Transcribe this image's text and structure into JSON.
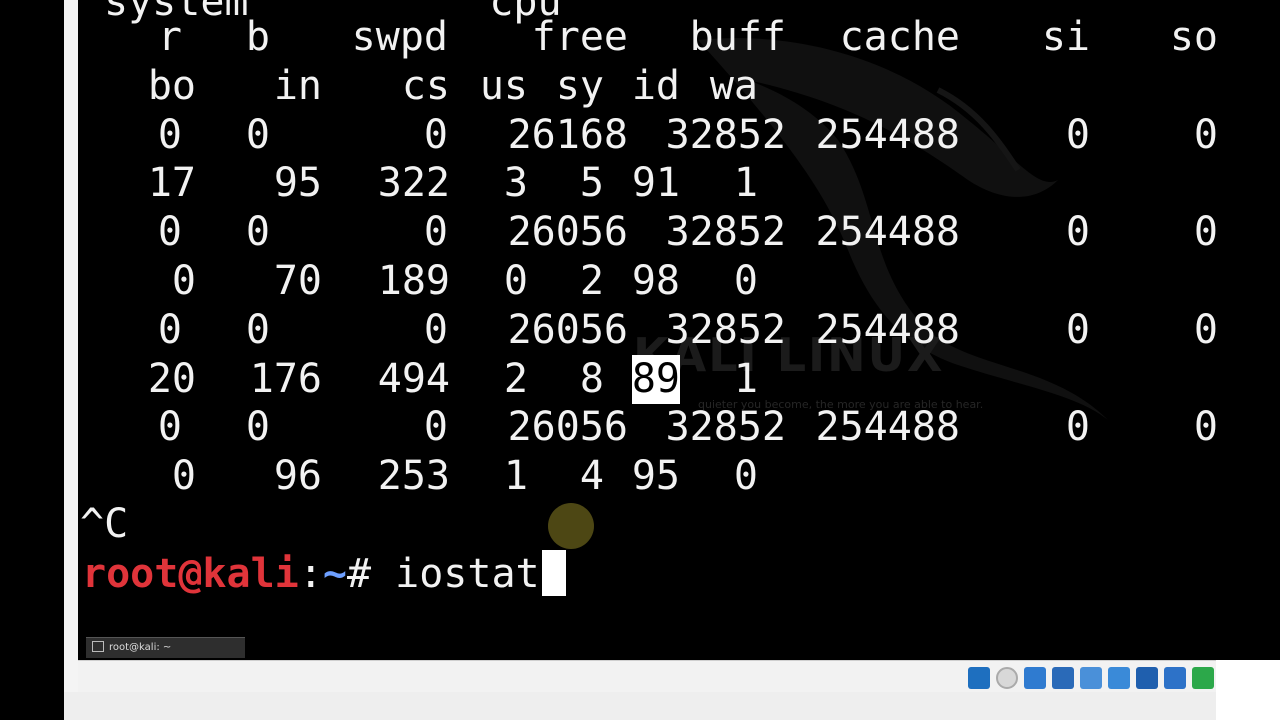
{
  "terminal": {
    "lines": [
      {
        "cells": [
          "r",
          "b",
          "swpd",
          "free",
          "buff",
          "cache",
          "si",
          "so"
        ]
      },
      {
        "cells": [
          "bo",
          "in",
          "cs",
          "us",
          "sy",
          "id",
          "wa"
        ]
      },
      {
        "cells": [
          "0",
          "0",
          "0",
          "26168",
          "32852",
          "254488",
          "0",
          "0"
        ]
      },
      {
        "cells": [
          "17",
          "95",
          "322",
          "3",
          "5",
          "91",
          "1"
        ]
      },
      {
        "cells": [
          "0",
          "0",
          "0",
          "26056",
          "32852",
          "254488",
          "0",
          "0"
        ]
      },
      {
        "cells": [
          "0",
          "70",
          "189",
          "0",
          "2",
          "98",
          "0"
        ]
      },
      {
        "cells": [
          "0",
          "0",
          "0",
          "26056",
          "32852",
          "254488",
          "0",
          "0"
        ]
      },
      {
        "cells": [
          "20",
          "176",
          "494",
          "2",
          "8",
          "89",
          "1"
        ]
      },
      {
        "cells": [
          "0",
          "0",
          "0",
          "26056",
          "32852",
          "254488",
          "0",
          "0"
        ]
      },
      {
        "cells": [
          "0",
          "96",
          "253",
          "1",
          "4",
          "95",
          "0"
        ]
      }
    ],
    "top_partial": "system          cpu",
    "interrupt": "^C",
    "prompt_user": "root@kali",
    "prompt_sep": ":",
    "prompt_path": "~",
    "prompt_symbol": "# ",
    "command": "iostat"
  },
  "watermark": {
    "title": "KALI LINUX",
    "tagline": "quieter you become, the more you are able to hear."
  },
  "taskbar": {
    "window_label": "root@kali: ~"
  },
  "statusbar": {
    "icons": [
      "help-icon",
      "optical-drive-icon",
      "usb-icon",
      "network-icon",
      "pen-icon",
      "shared-folder-icon",
      "display-icon",
      "snapshot-icon",
      "recording-icon"
    ]
  },
  "colors": {
    "prompt_user": "#e0343a",
    "prompt_path": "#6d9fff",
    "terminal_bg": "#000000",
    "terminal_fg": "#f2f2f2"
  }
}
